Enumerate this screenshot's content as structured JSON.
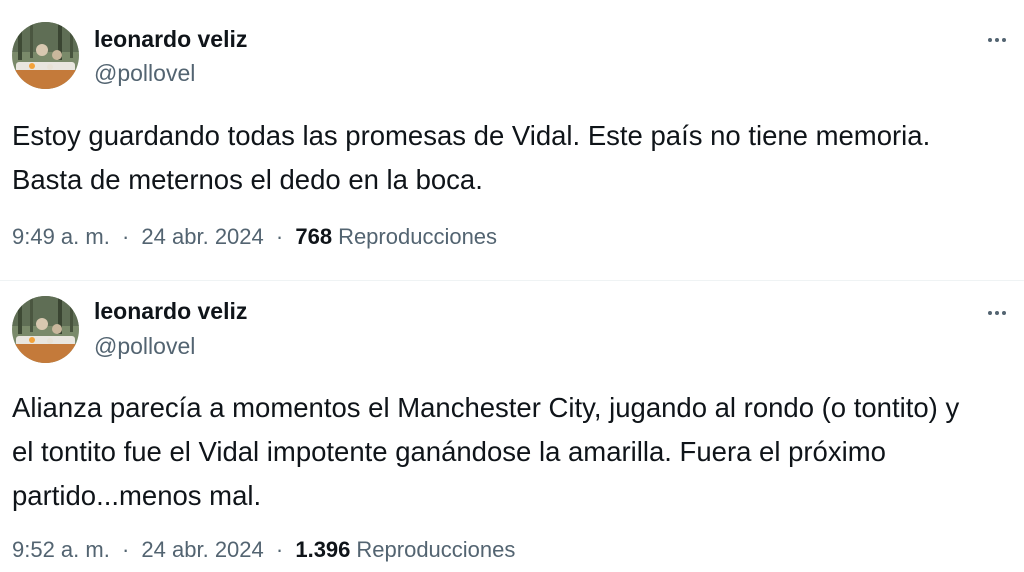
{
  "tweets": [
    {
      "author": {
        "display_name": "leonardo veliz",
        "handle": "@pollovel"
      },
      "text_lines": [
        "Estoy guardando todas las promesas de Vidal. Este país no tiene memoria.",
        "Basta de meternos el dedo en la boca."
      ],
      "time": "9:49 a. m.",
      "separator": "·",
      "date": "24 abr. 2024",
      "views_count": "768",
      "views_label": "Reproducciones",
      "more_icon": "more-horizontal-icon"
    },
    {
      "author": {
        "display_name": "leonardo veliz",
        "handle": "@pollovel"
      },
      "text_lines": [
        "Alianza parecía a momentos el Manchester City, jugando al rondo (o tontito) y",
        "el tontito fue el Vidal impotente ganándose la amarilla. Fuera el próximo",
        "partido...menos mal."
      ],
      "time": "9:52 a. m.",
      "separator": "·",
      "date": "24 abr. 2024",
      "views_count": "1.396",
      "views_label": "Reproducciones",
      "more_icon": "more-horizontal-icon"
    }
  ],
  "colors": {
    "primary_text": "#0f1419",
    "secondary_text": "#536471",
    "divider": "#eff3f4",
    "background": "#ffffff"
  }
}
